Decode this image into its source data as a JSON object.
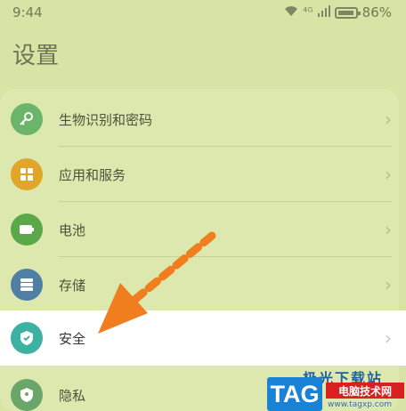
{
  "status_bar": {
    "time": "9:44",
    "network": "⁴ᴳ",
    "battery_percent": "86%",
    "battery_level": 0.86
  },
  "header": {
    "title": "设置"
  },
  "settings": {
    "items": [
      {
        "label": "生物识别和密码",
        "icon": "key-icon",
        "icon_color": "#6bb56a"
      },
      {
        "label": "应用和服务",
        "icon": "grid-icon",
        "icon_color": "#e1a52a"
      },
      {
        "label": "电池",
        "icon": "battery-icon",
        "icon_color": "#5aa84a"
      },
      {
        "label": "存储",
        "icon": "storage-icon",
        "icon_color": "#4f7fa3"
      },
      {
        "label": "安全",
        "icon": "shield-icon",
        "icon_color": "#3cb2a2"
      },
      {
        "label": "隐私",
        "icon": "privacy-shield-icon",
        "icon_color": "#6aa56a"
      }
    ]
  },
  "overlay": {
    "arrow_color": "#f07d1e"
  },
  "watermark": {
    "tag": "TAG",
    "site_top": "极光下载站",
    "site_name": "电脑技术网",
    "url": "www.tagxp.com"
  }
}
